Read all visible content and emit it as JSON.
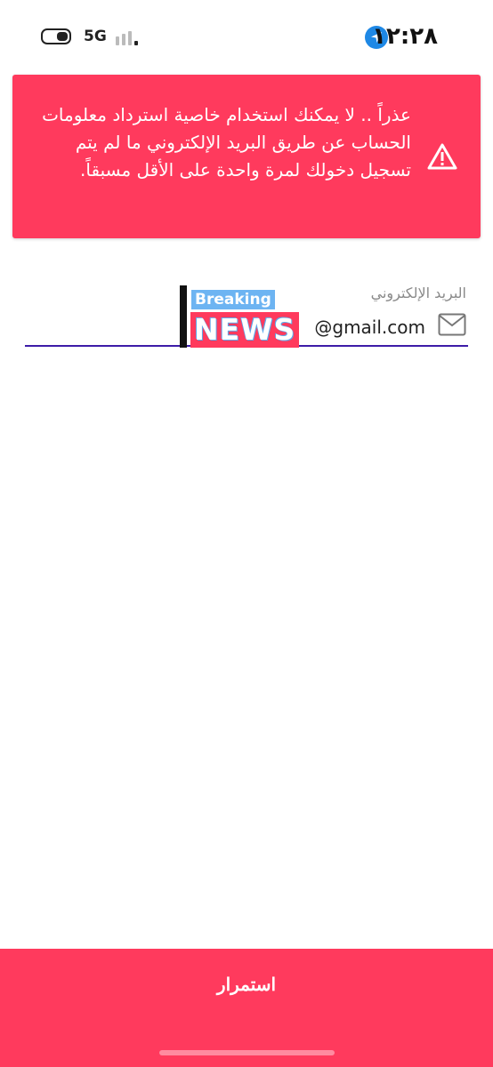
{
  "status_bar": {
    "time": "١٢:٢٨",
    "network": "5G",
    "icons": [
      "location-arrow-icon",
      "battery-icon",
      "signal-icon"
    ]
  },
  "alert": {
    "message": "عذراً .. لا يمكنك استخدام خاصية استرداد معلومات الحساب عن طريق البريد الإلكتروني ما لم يتم تسجيل دخولك لمرة واحدة على الأقل مسبقاً.",
    "icon": "warning-triangle-icon",
    "color": "#ff3a5d"
  },
  "email_field": {
    "label": "البريد الإلكتروني",
    "value": "@gmail.com",
    "icon": "mail-icon",
    "underline_color": "#3d1ca8"
  },
  "overlay_sticker": {
    "top_text": "Breaking",
    "bottom_text": "NEWS"
  },
  "footer": {
    "continue_label": "استمرار",
    "color": "#ff3a5d"
  }
}
